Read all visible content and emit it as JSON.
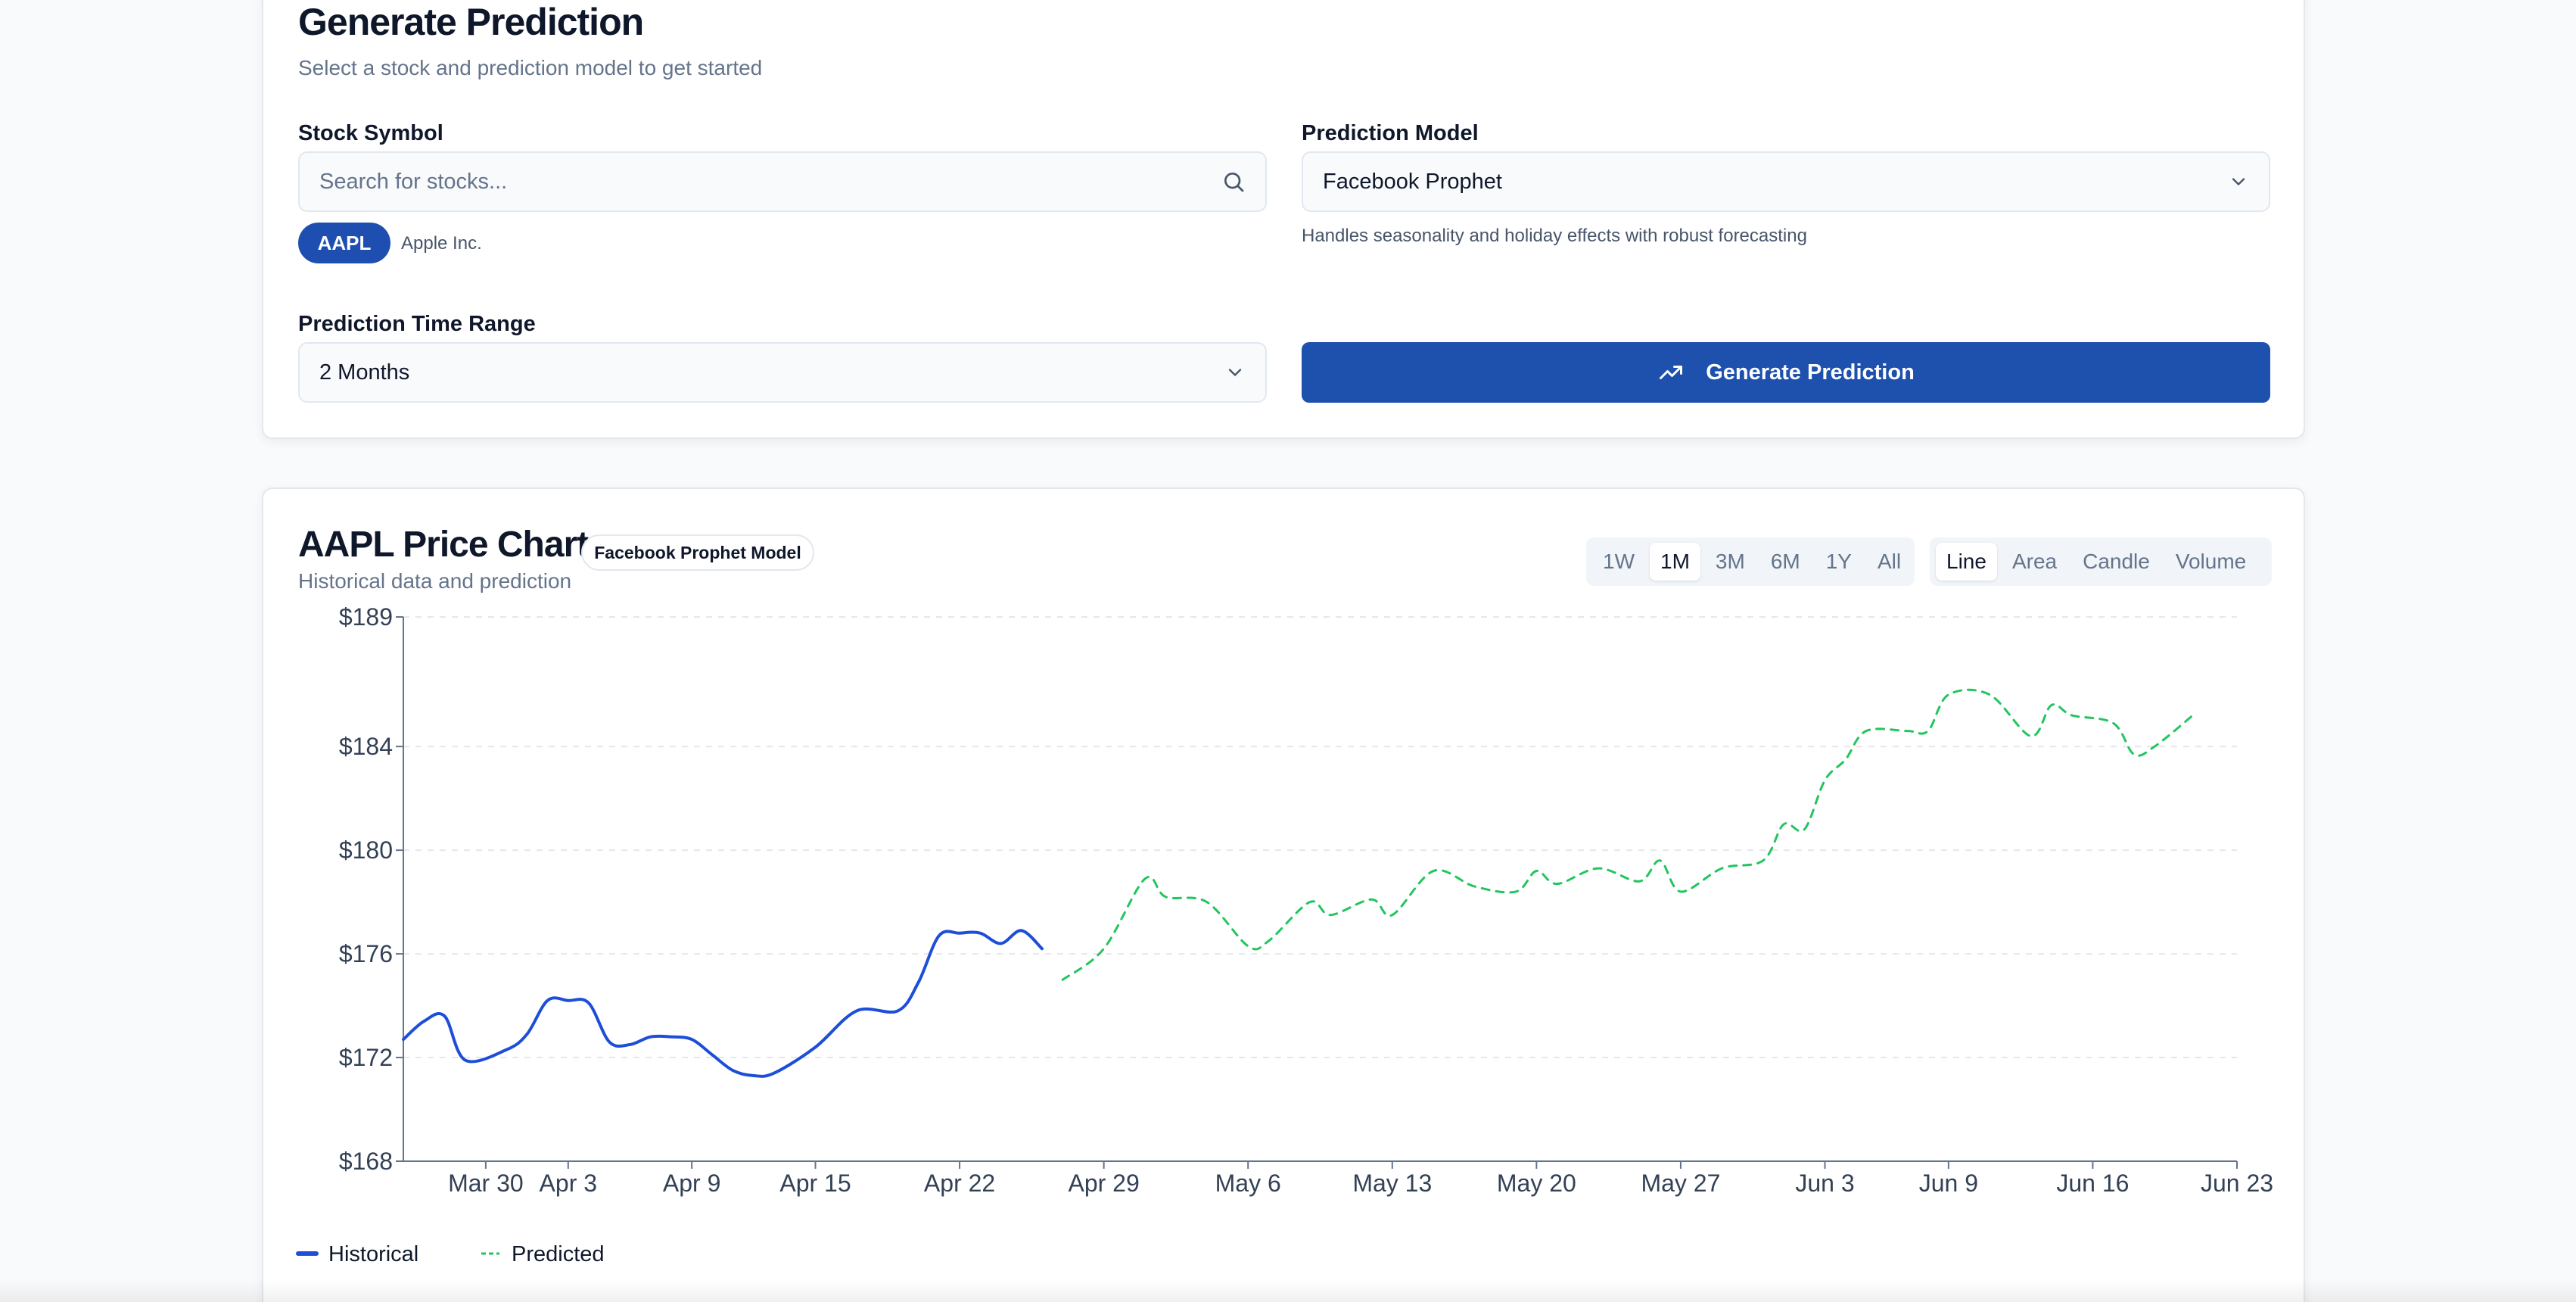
{
  "colors": {
    "primary": "#1e50ad",
    "historical_line": "#1d4ed8",
    "predicted_line": "#22c55e",
    "muted_text": "#64748b"
  },
  "predict_card": {
    "title": "Generate Prediction",
    "subtitle": "Select a stock and prediction model to get started",
    "stock_label": "Stock Symbol",
    "search_placeholder": "Search for stocks...",
    "search_icon": "search-icon",
    "selected_ticker": "AAPL",
    "selected_name": "Apple Inc.",
    "model_label": "Prediction Model",
    "model_value": "Facebook Prophet",
    "model_hint": "Handles seasonality and holiday effects with robust forecasting",
    "range_label": "Prediction Time Range",
    "range_value": "2 Months",
    "generate_icon": "trending-up-icon",
    "generate_label": "Generate Prediction"
  },
  "chart_card": {
    "title": "AAPL Price Chart",
    "model_badge": "Facebook Prophet Model",
    "subtitle": "Historical data and prediction",
    "range_options": [
      "1W",
      "1M",
      "3M",
      "6M",
      "1Y",
      "All"
    ],
    "range_selected": "1M",
    "type_options": [
      "Line",
      "Area",
      "Candle",
      "Volume"
    ],
    "type_selected": "Line"
  },
  "chart_data": {
    "type": "line",
    "title": "AAPL Price Chart",
    "xlabel": "",
    "ylabel": "",
    "x_axis_type": "date",
    "x_range": [
      "2024-03-26",
      "2024-06-23"
    ],
    "x_tick_dates": [
      "2024-03-30",
      "2024-04-03",
      "2024-04-09",
      "2024-04-15",
      "2024-04-22",
      "2024-04-29",
      "2024-05-06",
      "2024-05-13",
      "2024-05-20",
      "2024-05-27",
      "2024-06-03",
      "2024-06-09",
      "2024-06-16",
      "2024-06-23"
    ],
    "x_tick_labels": [
      "Mar 30",
      "Apr 3",
      "Apr 9",
      "Apr 15",
      "Apr 22",
      "Apr 29",
      "May 6",
      "May 13",
      "May 20",
      "May 27",
      "Jun 3",
      "Jun 9",
      "Jun 16",
      "Jun 23"
    ],
    "ylim": [
      168,
      189
    ],
    "y_ticks": [
      168,
      172,
      176,
      180,
      184,
      189
    ],
    "y_tick_labels": [
      "$168",
      "$172",
      "$176",
      "$180",
      "$184",
      "$189"
    ],
    "grid": true,
    "legend_position": "bottom-left",
    "series": [
      {
        "name": "Historical",
        "style": "solid",
        "color": "#1d4ed8",
        "points": [
          [
            "2024-03-26",
            172.7
          ],
          [
            "2024-03-27",
            173.4
          ],
          [
            "2024-03-28",
            173.6
          ],
          [
            "2024-03-29",
            171.9
          ],
          [
            "2024-03-31",
            172.3
          ],
          [
            "2024-04-01",
            172.9
          ],
          [
            "2024-04-02",
            174.2
          ],
          [
            "2024-04-03",
            174.2
          ],
          [
            "2024-04-04",
            174.1
          ],
          [
            "2024-04-05",
            172.6
          ],
          [
            "2024-04-06",
            172.5
          ],
          [
            "2024-04-07",
            172.8
          ],
          [
            "2024-04-08",
            172.8
          ],
          [
            "2024-04-09",
            172.7
          ],
          [
            "2024-04-10",
            172.1
          ],
          [
            "2024-04-11",
            171.5
          ],
          [
            "2024-04-12",
            171.3
          ],
          [
            "2024-04-13",
            171.4
          ],
          [
            "2024-04-15",
            172.4
          ],
          [
            "2024-04-17",
            173.8
          ],
          [
            "2024-04-19",
            173.8
          ],
          [
            "2024-04-20",
            174.9
          ],
          [
            "2024-04-21",
            176.7
          ],
          [
            "2024-04-22",
            176.8
          ],
          [
            "2024-04-23",
            176.8
          ],
          [
            "2024-04-24",
            176.4
          ],
          [
            "2024-04-25",
            176.9
          ],
          [
            "2024-04-26",
            176.2
          ]
        ]
      },
      {
        "name": "Predicted",
        "style": "dashed",
        "color": "#22c55e",
        "points": [
          [
            "2024-04-27",
            175.0
          ],
          [
            "2024-04-29",
            176.2
          ],
          [
            "2024-05-01",
            178.9
          ],
          [
            "2024-05-02",
            178.2
          ],
          [
            "2024-05-04",
            178.0
          ],
          [
            "2024-05-06",
            176.3
          ],
          [
            "2024-05-07",
            176.5
          ],
          [
            "2024-05-09",
            178.0
          ],
          [
            "2024-05-10",
            177.5
          ],
          [
            "2024-05-12",
            178.1
          ],
          [
            "2024-05-13",
            177.5
          ],
          [
            "2024-05-15",
            179.2
          ],
          [
            "2024-05-17",
            178.6
          ],
          [
            "2024-05-19",
            178.4
          ],
          [
            "2024-05-20",
            179.2
          ],
          [
            "2024-05-21",
            178.7
          ],
          [
            "2024-05-23",
            179.3
          ],
          [
            "2024-05-25",
            178.8
          ],
          [
            "2024-05-26",
            179.6
          ],
          [
            "2024-05-27",
            178.4
          ],
          [
            "2024-05-29",
            179.3
          ],
          [
            "2024-05-31",
            179.6
          ],
          [
            "2024-06-01",
            181.0
          ],
          [
            "2024-06-02",
            180.8
          ],
          [
            "2024-06-03",
            182.7
          ],
          [
            "2024-06-04",
            183.5
          ],
          [
            "2024-06-05",
            184.6
          ],
          [
            "2024-06-07",
            184.6
          ],
          [
            "2024-06-08",
            184.6
          ],
          [
            "2024-06-09",
            186.0
          ],
          [
            "2024-06-11",
            186.0
          ],
          [
            "2024-06-13",
            184.4
          ],
          [
            "2024-06-14",
            185.6
          ],
          [
            "2024-06-15",
            185.2
          ],
          [
            "2024-06-17",
            184.9
          ],
          [
            "2024-06-18",
            183.7
          ],
          [
            "2024-06-19",
            184.0
          ],
          [
            "2024-06-21",
            185.3
          ]
        ]
      }
    ]
  }
}
